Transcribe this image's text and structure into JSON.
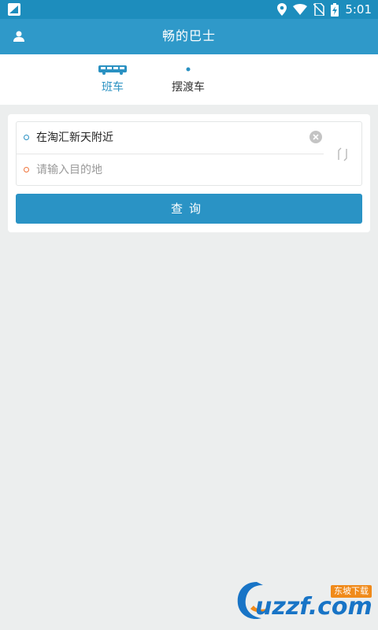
{
  "status_bar": {
    "time": "5:01",
    "icons": [
      "app-icon",
      "location-icon",
      "wifi-icon",
      "no-sim-icon",
      "battery-charging-icon"
    ]
  },
  "app_bar": {
    "title": "畅的巴士",
    "left_icon": "user-icon"
  },
  "tabs": [
    {
      "label": "班车",
      "icon": "bus-icon",
      "selected": true
    },
    {
      "label": "摆渡车",
      "icon": "dot-icon",
      "selected": false
    }
  ],
  "route_form": {
    "from_value": "在淘汇新天附近",
    "to_placeholder": "请输入目的地",
    "clear_icon": "clear-icon",
    "swap_icon": "swap-icon",
    "query_label": "查询"
  },
  "watermark": {
    "main": "uzzf.com",
    "badge": "东坡下载"
  },
  "colors": {
    "accent": "#2a91c2",
    "app_bar": "#2f99c9",
    "status_bar": "#1d8dbd",
    "to_dot": "#f0743c"
  }
}
